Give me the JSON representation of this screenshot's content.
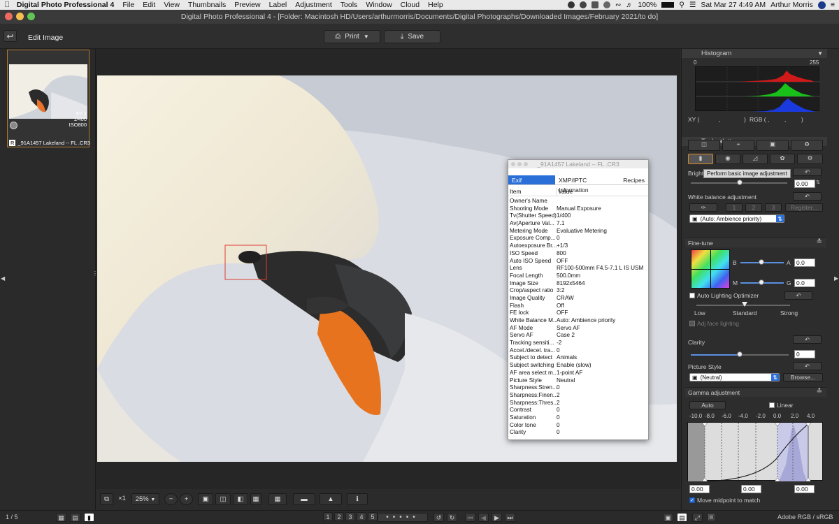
{
  "menubar": {
    "apple": "",
    "app_name": "Digital Photo Professional 4",
    "items": [
      "File",
      "Edit",
      "View",
      "Thumbnails",
      "Preview",
      "Label",
      "Adjustment",
      "Tools",
      "Window",
      "Cloud",
      "Help"
    ],
    "battery": "100%",
    "datetime": "Sat Mar 27  4:49 AM",
    "user": "Arthur Morris"
  },
  "window": {
    "title": "Digital Photo Professional 4 - [Folder: Macintosh HD/Users/arthurmorris/Documents/Digital Photographs/Downloaded Images/February 2021/to do]"
  },
  "toolbar": {
    "mode_label": "Edit Image",
    "print_label": "Print",
    "save_label": "Save"
  },
  "thumbnail": {
    "aperture": "F7.1",
    "shutter": "1/400",
    "iso": "ISO800",
    "filename": "_91A1457  Lakeland -- FL .CR3",
    "badge": "R"
  },
  "exif": {
    "window_title": "_91A1457  Lakeland -- FL .CR3",
    "tabs": [
      "Exif Information",
      "XMP/IPTC Information",
      "Recipes"
    ],
    "col_item": "Item",
    "col_value": "Value",
    "rows": [
      [
        "Owner's Name",
        ""
      ],
      [
        "Shooting Mode",
        "Manual Exposure"
      ],
      [
        "Tv(Shutter Speed)",
        "1/400"
      ],
      [
        "Av(Aperture Val...",
        "7.1"
      ],
      [
        "Metering Mode",
        "Evaluative Metering"
      ],
      [
        "Exposure Comp...",
        "0"
      ],
      [
        "Autoexposure Br...",
        "+1/3"
      ],
      [
        "ISO Speed",
        "800"
      ],
      [
        "Auto ISO Speed",
        "OFF"
      ],
      [
        "Lens",
        "RF100-500mm F4.5-7.1 L IS USM"
      ],
      [
        "Focal Length",
        "500.0mm"
      ],
      [
        "Image Size",
        "8192x5464"
      ],
      [
        "Crop/aspect ratio",
        "3:2"
      ],
      [
        "Image Quality",
        "CRAW"
      ],
      [
        "Flash",
        "Off"
      ],
      [
        "FE lock",
        "OFF"
      ],
      [
        "White Balance M...",
        "Auto: Ambience priority"
      ],
      [
        "AF Mode",
        "Servo AF"
      ],
      [
        "Servo AF",
        "Case 2"
      ],
      [
        "Tracking sensiti...",
        "-2"
      ],
      [
        "Accel./decel. tra...",
        "0"
      ],
      [
        "Subject to detect",
        "Animals"
      ],
      [
        "Subject switching",
        "Enable (slow)"
      ],
      [
        "AF area select m...",
        "1-point AF"
      ],
      [
        "Picture Style",
        "Neutral"
      ],
      [
        "Sharpness:Stren...",
        "0"
      ],
      [
        "Sharpness:Finen...",
        "2"
      ],
      [
        "Sharpness:Thres...",
        "2"
      ],
      [
        "Contrast",
        "0"
      ],
      [
        "Saturation",
        "0"
      ],
      [
        "Color tone",
        "0"
      ],
      [
        "Clarity",
        "0"
      ]
    ]
  },
  "histogram": {
    "title": "Histogram",
    "min": "0",
    "max": "255",
    "xy_label": "XY (",
    "xy_sep": ",",
    "xy_close": ")",
    "rgb_label": "RGB (",
    "rgb_sep1": ",",
    "rgb_sep2": ",",
    "rgb_close": ")"
  },
  "tool_palette": {
    "title": "Tool palette",
    "brightness_label": "Bright",
    "tooltip": "Perform basic image adjustment",
    "brightness_value": "0.00",
    "wb_label": "White balance adjustment",
    "wb_presets": [
      "1",
      "2",
      "3"
    ],
    "register_label": "Register...",
    "wb_mode": "(Auto: Ambience priority)"
  },
  "finetune": {
    "title": "Fine-tune",
    "b_label": "B",
    "a_label": "A",
    "m_label": "M",
    "g_label": "G",
    "a_value": "0.0",
    "g_value": "0.0",
    "alo_label": "Auto Lighting Optimizer",
    "low": "Low",
    "standard": "Standard",
    "strong": "Strong",
    "adj_face": "Adj face lighting",
    "clarity_label": "Clarity",
    "clarity_value": "0",
    "picture_style_label": "Picture Style",
    "picture_style_value": "(Neutral)",
    "browse_label": "Browse..."
  },
  "gamma": {
    "title": "Gamma adjustment",
    "auto_label": "Auto",
    "linear_label": "Linear",
    "ticks": [
      "-10.0",
      "-8.0",
      "-6.0",
      "-4.0",
      "-2.0",
      "0.0",
      "2.0",
      "4.0"
    ],
    "val1": "0.00",
    "val2": "0.00",
    "val3": "0.00",
    "midpoint_label": "Move midpoint to match"
  },
  "viewer": {
    "zoom_mult": "×1",
    "zoom_percent": "25%"
  },
  "bottom": {
    "page": "1 / 5",
    "ratings": [
      "1",
      "2",
      "3",
      "4",
      "5"
    ],
    "colorspace": "Adobe RGB / sRGB"
  }
}
